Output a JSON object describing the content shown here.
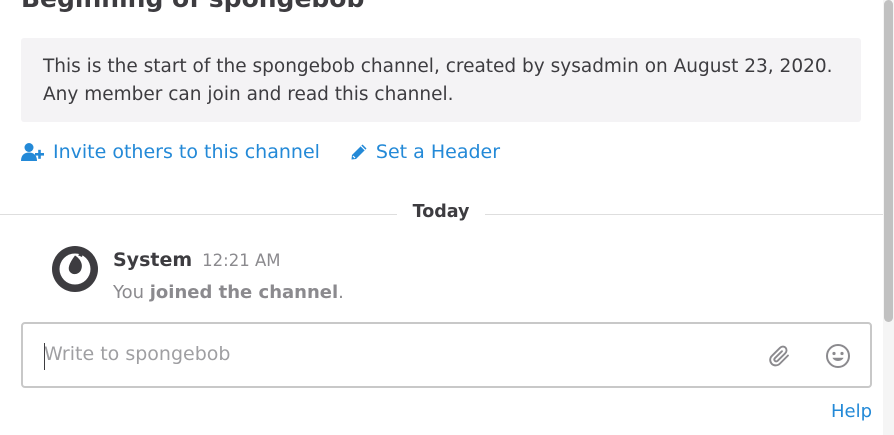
{
  "channel": {
    "title": "Beginning of spongebob",
    "intro_line1": "This is the start of the spongebob channel, created by sysadmin on August 23, 2020.",
    "intro_line2": "Any member can join and read this channel."
  },
  "actions": {
    "invite_label": "Invite others to this channel",
    "invite_icon": "add-user-icon",
    "header_label": "Set a Header",
    "header_icon": "pencil-icon"
  },
  "date_separator": "Today",
  "post": {
    "author": "System",
    "time": "12:21 AM",
    "message_prefix": "You ",
    "message_bold": "joined the channel",
    "message_suffix": ".",
    "avatar_icon": "mattermost-logo-icon"
  },
  "composer": {
    "placeholder": "Write to spongebob",
    "attach_icon": "paperclip-icon",
    "emoji_icon": "smiley-icon"
  },
  "help_label": "Help",
  "colors": {
    "link": "#2389d7",
    "text": "#3d3c40",
    "muted": "#8b8a8e",
    "intro_bg": "#f4f3f5"
  }
}
